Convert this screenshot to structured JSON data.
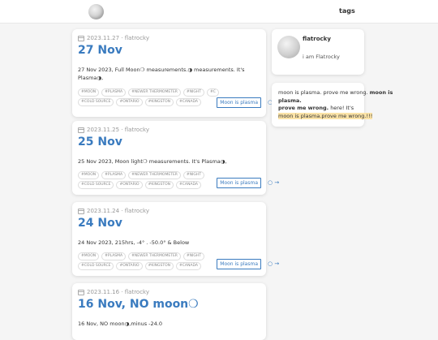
{
  "header": {
    "logo_alt": "moon",
    "nav_tags": "tags"
  },
  "posts": [
    {
      "meta": "2023.11.27 · flatrocky",
      "title": "27 Nov",
      "excerpt": "27 Nov 2023, Full Moon❍ measurements.◑ measurements. It's Plasma◑,",
      "tags": [
        "#MOON",
        "#PLASMA",
        "#NEWER THERMOMETER",
        "#NIGHT",
        "#C",
        "#COLD SOURCE",
        "#ONTARIO",
        "#KINGSTON",
        "#CANADA"
      ],
      "more_label": "Moon is plasma",
      "more_arrow": "○ →"
    },
    {
      "meta": "2023.11.25 · flatrocky",
      "title": "25 Nov",
      "excerpt": "25 Nov 2023, Moon light❍ measurements. It's Plasma◑,",
      "tags": [
        "#MOON",
        "#PLASMA",
        "#NEWER THERMOMETER",
        "#NIGHT",
        "#COLD SOURCE",
        "#ONTARIO",
        "#KINGSTON",
        "#CANADA"
      ],
      "more_label": "Moon is plasma",
      "more_arrow": "○ →"
    },
    {
      "meta": "2023.11.24 · flatrocky",
      "title": "24 Nov",
      "excerpt": "24 Nov 2023, 215hrs, -4° . -50.0° & Below",
      "tags": [
        "#MOON",
        "#PLASMA",
        "#NEWER THERMOMETER",
        "#NIGHT",
        "#COLD SOURCE",
        "#ONTARIO",
        "#KINGSTON",
        "#CANADA"
      ],
      "more_label": "Moon is plasma",
      "more_arrow": "○ →"
    },
    {
      "meta": "2023.11.16 · flatrocky",
      "title": "16 Nov, NO moon❍",
      "excerpt": "16 Nov, NO moon◑,minus -24.0"
    }
  ],
  "profile": {
    "name": "flatrocky",
    "bio": "i am Flatrocky"
  },
  "note": {
    "line1": "moon is plasma. prove me wrong.",
    "line1_bold": "moon is plasma.",
    "line2_bold": "prove me wrong.",
    "line2_tail": "here! It's",
    "line3_highlight": "moon is plasma.prove me wrong.!!!"
  },
  "colors": {
    "accent": "#3a7bbf",
    "highlight": "#fbe3a7"
  }
}
